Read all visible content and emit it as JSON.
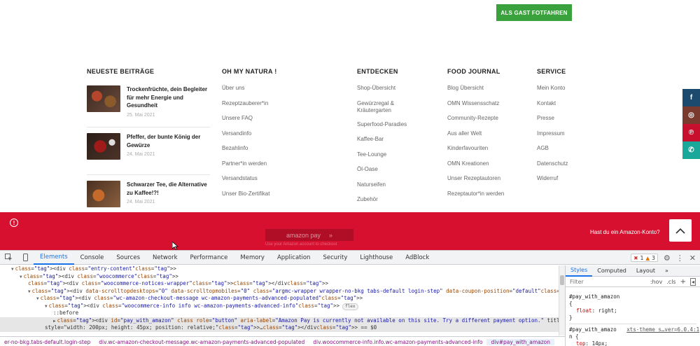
{
  "site": {
    "guest_button": "ALS GAST FOTFAHREN",
    "posts": {
      "heading": "NEUESTE BEITRÄGE",
      "items": [
        {
          "title": "Trockenfrüchte, dein Begleiter für mehr Energie und Gesundheit",
          "date": "25. Mai 2021"
        },
        {
          "title": "Pfeffer, der bunte König der Gewürze",
          "date": "24. Mai 2021"
        },
        {
          "title": "Schwarzer Tee, die Alternative zu Kaffee!?!",
          "date": "24. Mai 2021"
        }
      ]
    },
    "columns": [
      {
        "heading": "OH MY NATURA !",
        "links": [
          "Über uns",
          "Rezeptzauberer*in",
          "Unsere FAQ",
          "Versandinfo",
          "Bezahlinfo",
          "Partner*in werden",
          "Versandstatus",
          "Unser Bio-Zertifikat"
        ]
      },
      {
        "heading": "ENTDECKEN",
        "links": [
          "Shop-Übersicht",
          "Gewürzregal & Kräutergarten",
          "Superfood-Paradies",
          "Kaffee-Bar",
          "Tee-Lounge",
          "Öl-Oase",
          "Naturseifen",
          "Zubehör"
        ]
      },
      {
        "heading": "FOOD JOURNAL",
        "links": [
          "Blog Übersicht",
          "OMN Wissensschatz",
          "Community-Rezepte",
          "Aus aller Welt",
          "Kinderfavouriten",
          "OMN Kreationen",
          "Unser Rezeptautoren",
          "Rezeptautor*in werden"
        ]
      },
      {
        "heading": "SERVICE",
        "links": [
          "Mein Konto",
          "Kontakt",
          "Presse",
          "Impressum",
          "AGB",
          "Datenschutz",
          "Widerruf"
        ]
      }
    ],
    "social": [
      {
        "icon": "facebook-icon",
        "glyph": "f",
        "color": "#1c4a6e"
      },
      {
        "icon": "instagram-icon",
        "glyph": "◎",
        "color": "#7a3b2e"
      },
      {
        "icon": "pinterest-icon",
        "glyph": "℗",
        "color": "#c8102e"
      },
      {
        "icon": "whatsapp-icon",
        "glyph": "✆",
        "color": "#1aa89a"
      }
    ],
    "notice": {
      "alert_glyph": "!",
      "amazon_label": "amazon pay",
      "amazon_arrows": "»",
      "amazon_note": "Use your Amazon account to checkout",
      "question": "Hast du ein Amazon-Konto?"
    },
    "colors": {
      "accent_green": "#3aa23c",
      "notice_red": "#d7102f"
    }
  },
  "devtools": {
    "tabs": [
      "Elements",
      "Console",
      "Sources",
      "Network",
      "Performance",
      "Memory",
      "Application",
      "Security",
      "Lighthouse",
      "AdBlock"
    ],
    "active_tab": "Elements",
    "errors": "1",
    "warnings": "3",
    "dom_lines": [
      {
        "indent": 1,
        "arrow": "▼",
        "html": "<div class=\"entry-content\">"
      },
      {
        "indent": 2,
        "arrow": "▼",
        "html": "<div class=\"woocommerce\">"
      },
      {
        "indent": 3,
        "arrow": "",
        "html": "<div class=\"woocommerce-notices-wrapper\"></div>"
      },
      {
        "indent": 3,
        "arrow": "▼",
        "html": "<div data-scrolltopdesktops=\"0\" data-scrolltopmobiles=\"0\" class=\"argmc-wrapper wrapper-no-bkg tabs-default login-step\" data-coupon-position=\"default\">"
      },
      {
        "indent": 4,
        "arrow": "▼",
        "html": "<div class=\"wc-amazon-checkout-message wc-amazon-payments-advanced-populated\">"
      },
      {
        "indent": 5,
        "arrow": "▼",
        "html": "<div class=\"woocommerce-info info wc-amazon-payments-advanced-info\">",
        "pill": "flex"
      },
      {
        "indent": 6,
        "arrow": "",
        "html": "::before"
      },
      {
        "indent": 6,
        "arrow": "▶",
        "html": "<div id=\"pay_with_amazon\" class role=\"button\" aria-label=\"Amazon Pay is currently not available on this site. Try a different payment option.\" title",
        "selected": true
      },
      {
        "indent": 6,
        "arrow": "",
        "html": "style=\"width: 200px; height: 45px; position: relative;\">…</div> == $0",
        "selected": true
      }
    ],
    "breadcrumbs": [
      "er-no-bkg.tabs-default.login-step",
      "div.wc-amazon-checkout-message.wc-amazon-payments-advanced-populated",
      "div.woocommerce-info.info.wc-amazon-payments-advanced-info",
      "div#pay_with_amazon"
    ],
    "styles": {
      "tabs": [
        "Styles",
        "Computed",
        "Layout",
        "»"
      ],
      "active_tab": "Styles",
      "filter_placeholder": "Filter",
      "hov": ":hov",
      "cls": ".cls",
      "plus": "+",
      "rules": [
        {
          "selector": "#pay_with_amazon",
          "open": "{",
          "prop": "float",
          "value": "right;",
          "close": "}"
        },
        {
          "selector": "#pay_with_amazo",
          "source": "xts-theme_s…ver=6.0.4:1",
          "selector2": "n {",
          "prop": "top",
          "value": "14px;"
        }
      ]
    }
  }
}
